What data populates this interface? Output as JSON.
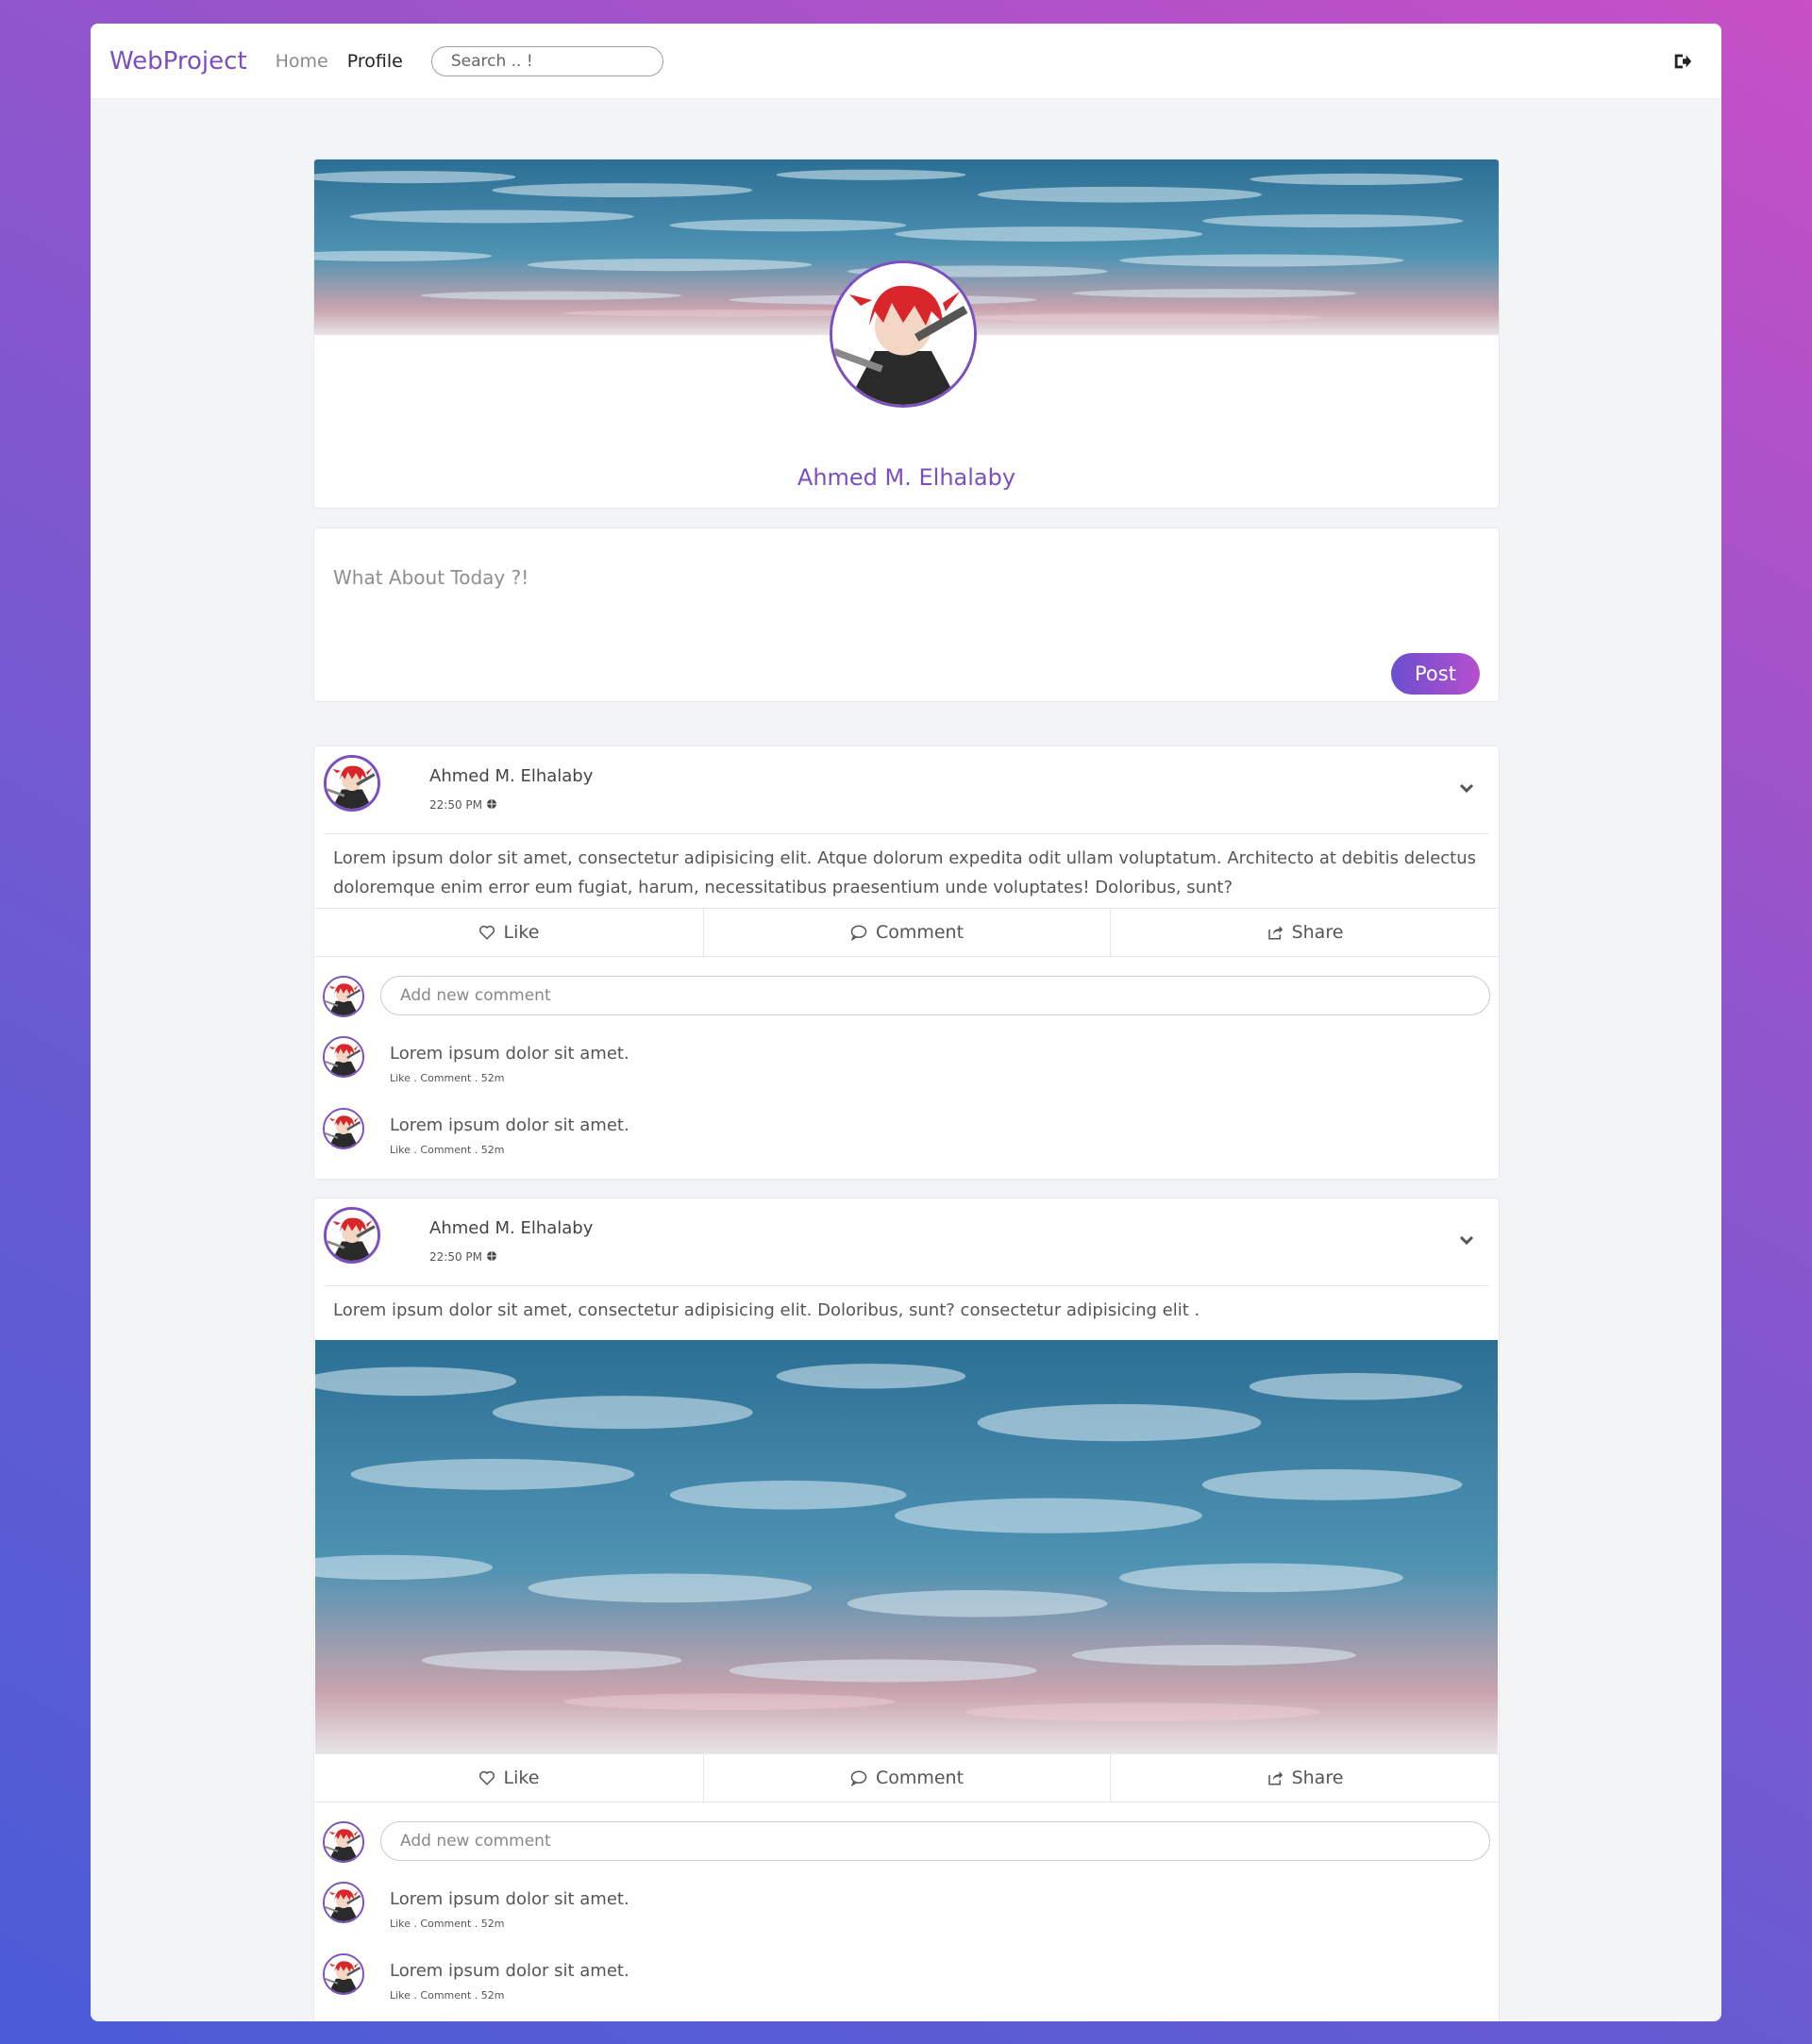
{
  "app": {
    "brand": "WebProject"
  },
  "nav": {
    "home": "Home",
    "profile": "Profile",
    "search_placeholder": "Search .. !"
  },
  "icons": {
    "logout": "sign-out-icon",
    "dropdown": "chevron-down-icon",
    "like": "heart-icon",
    "comment": "speech-bubble-icon",
    "share": "share-icon",
    "globe": "globe-icon"
  },
  "profile": {
    "name": "Ahmed M. Elhalaby"
  },
  "composer": {
    "placeholder": "What About Today ?!",
    "post_label": "Post"
  },
  "actions": {
    "like": "Like",
    "comment": "Comment",
    "share": "Share"
  },
  "comment_placeholder": "Add new comment",
  "posts": [
    {
      "author": "Ahmed M. Elhalaby",
      "time": "22:50 PM",
      "text": "Lorem ipsum dolor sit amet, consectetur adipisicing elit. Atque dolorum expedita odit ullam voluptatum. Architecto at debitis delectus doloremque enim error eum fugiat, harum, necessitatibus praesentium unde voluptates! Doloribus, sunt?",
      "comments": [
        {
          "text": "Lorem ipsum dolor sit amet.",
          "meta": "Like . Comment . 52m"
        },
        {
          "text": "Lorem ipsum dolor sit amet.",
          "meta": "Like . Comment . 52m"
        }
      ]
    },
    {
      "author": "Ahmed M. Elhalaby",
      "time": "22:50 PM",
      "text": "Lorem ipsum dolor sit amet, consectetur adipisicing elit. Doloribus, sunt? consectetur adipisicing elit .",
      "comments": [
        {
          "text": "Lorem ipsum dolor sit amet.",
          "meta": "Like . Comment . 52m"
        },
        {
          "text": "Lorem ipsum dolor sit amet.",
          "meta": "Like . Comment . 52m"
        }
      ]
    }
  ],
  "colors": {
    "accent": "#7b4fc2",
    "gradient_start": "#6b4fcf",
    "gradient_end": "#b54fcd"
  }
}
